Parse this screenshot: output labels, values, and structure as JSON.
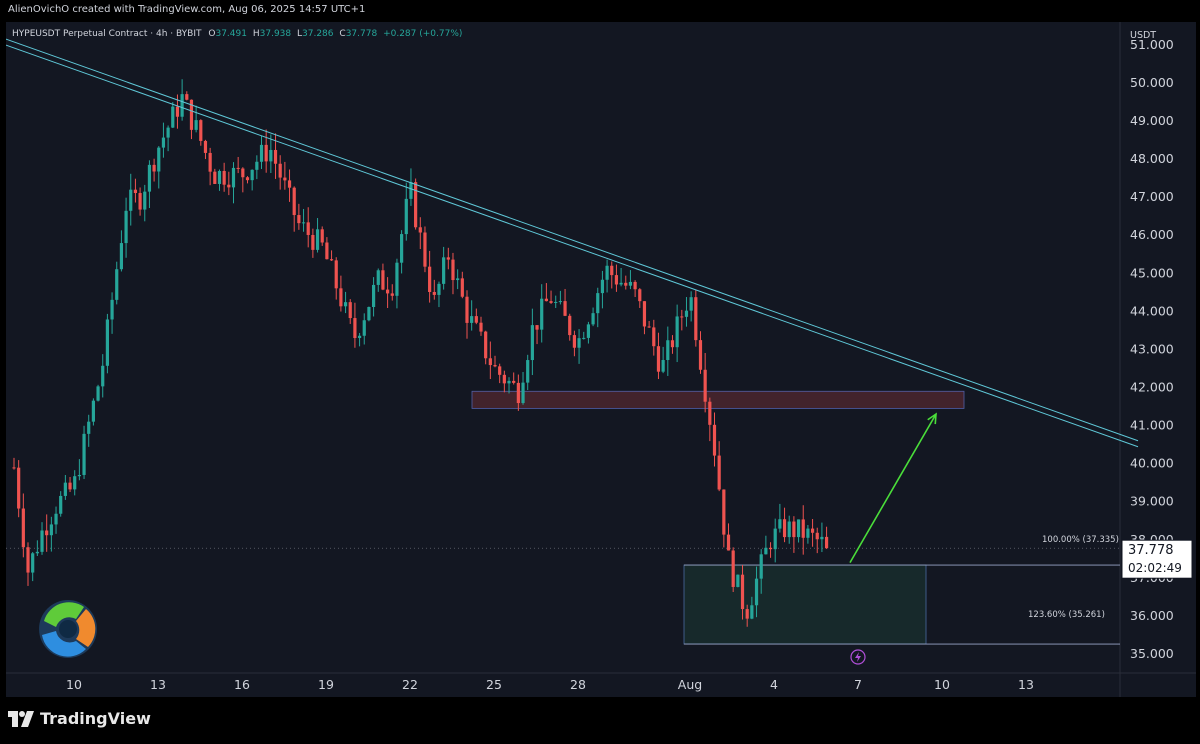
{
  "header": {
    "credit": "AlienOvichO created with TradingView.com, Aug 06, 2025 14:57 UTC+1"
  },
  "legend": {
    "symbol": "HYPEUSDT Perpetual Contract · 4h · BYBIT",
    "o_label": "O",
    "o_value": "37.491",
    "h_label": "H",
    "h_value": "37.938",
    "l_label": "L",
    "l_value": "37.286",
    "c_label": "C",
    "c_value": "37.778",
    "change": "+0.287 (+0.77%)"
  },
  "price_scale": {
    "currency": "USDT",
    "ticks": [
      "51.000",
      "50.000",
      "49.000",
      "48.000",
      "47.000",
      "46.000",
      "45.000",
      "44.000",
      "43.000",
      "42.000",
      "41.000",
      "40.000",
      "39.000",
      "38.000",
      "37.000",
      "36.000",
      "35.000"
    ]
  },
  "last_price": {
    "value": "37.778",
    "countdown": "02:02:49"
  },
  "fib_labels": {
    "level_100": "100.00% (37.335)",
    "level_123": "123.60% (35.261)"
  },
  "time_axis": {
    "ticks": [
      "10",
      "13",
      "16",
      "19",
      "22",
      "25",
      "28",
      "Aug",
      "4",
      "7",
      "10",
      "13"
    ]
  },
  "footer": {
    "brand": "TradingView"
  },
  "colors": {
    "background": "#131722",
    "up": "#26a69a",
    "down": "#ef5350",
    "trendline": "#5fc8d8",
    "arrow": "#4ade3a",
    "resistance_zone": "#ef5350",
    "support_zone": "#2e7d5b"
  },
  "chart_data": {
    "type": "candlestick",
    "timeframe": "4h",
    "y_unit": "USDT",
    "ylim": [
      34.5,
      51.6
    ],
    "x_ticks": [
      {
        "label": "10",
        "date": "2025-07-10"
      },
      {
        "label": "13",
        "date": "2025-07-13"
      },
      {
        "label": "16",
        "date": "2025-07-16"
      },
      {
        "label": "19",
        "date": "2025-07-19"
      },
      {
        "label": "22",
        "date": "2025-07-22"
      },
      {
        "label": "25",
        "date": "2025-07-25"
      },
      {
        "label": "28",
        "date": "2025-07-28"
      },
      {
        "label": "Aug",
        "date": "2025-08-01"
      },
      {
        "label": "4",
        "date": "2025-08-04"
      },
      {
        "label": "7",
        "date": "2025-08-07"
      },
      {
        "label": "10",
        "date": "2025-08-10"
      },
      {
        "label": "13",
        "date": "2025-08-13"
      }
    ],
    "path_dates": [
      "2025-07-08",
      "2025-07-08",
      "2025-07-09",
      "2025-07-09",
      "2025-07-10",
      "2025-07-11",
      "2025-07-12",
      "2025-07-12",
      "2025-07-13",
      "2025-07-14",
      "2025-07-14",
      "2025-07-15",
      "2025-07-16",
      "2025-07-17",
      "2025-07-18",
      "2025-07-19",
      "2025-07-19",
      "2025-07-20",
      "2025-07-21",
      "2025-07-21",
      "2025-07-22",
      "2025-07-23",
      "2025-07-23",
      "2025-07-24",
      "2025-07-25",
      "2025-07-26",
      "2025-07-26",
      "2025-07-27",
      "2025-07-28",
      "2025-07-29",
      "2025-07-30",
      "2025-07-31",
      "2025-08-01",
      "2025-08-02",
      "2025-08-02",
      "2025-08-03",
      "2025-08-04",
      "2025-08-04",
      "2025-08-05",
      "2025-08-06"
    ],
    "path_prices": [
      39.9,
      37.2,
      38.2,
      38.9,
      39.4,
      42.5,
      46.8,
      47.0,
      48.3,
      49.6,
      48.8,
      47.6,
      47.6,
      48.3,
      46.3,
      45.7,
      44.7,
      43.3,
      44.8,
      44.7,
      47.2,
      44.2,
      45.5,
      44.0,
      42.5,
      41.9,
      43.5,
      44.4,
      43.2,
      45.1,
      44.5,
      42.5,
      44.5,
      40.5,
      37.5,
      36.1,
      38.0,
      38.3,
      38.2,
      37.778
    ],
    "trendline": {
      "start": {
        "date": "2025-07-07",
        "price": 51.3
      },
      "end": {
        "date": "2025-08-17",
        "price": 40.6
      }
    },
    "resistance_zone": {
      "from_date": "2025-07-24",
      "to_date": "2025-08-10",
      "low": 41.45,
      "high": 41.9
    },
    "support_zone": {
      "from_date": "2025-08-01",
      "to_date": "2025-08-10",
      "low": 35.261,
      "high": 37.335
    },
    "fib_levels": [
      {
        "level": "100.00%",
        "price": 37.335
      },
      {
        "level": "123.60%",
        "price": 35.261
      }
    ],
    "projection_arrow": {
      "from": {
        "date": "2025-08-07",
        "price": 37.4
      },
      "to": {
        "date": "2025-08-10",
        "price": 41.3
      }
    },
    "last_price": 37.778
  }
}
